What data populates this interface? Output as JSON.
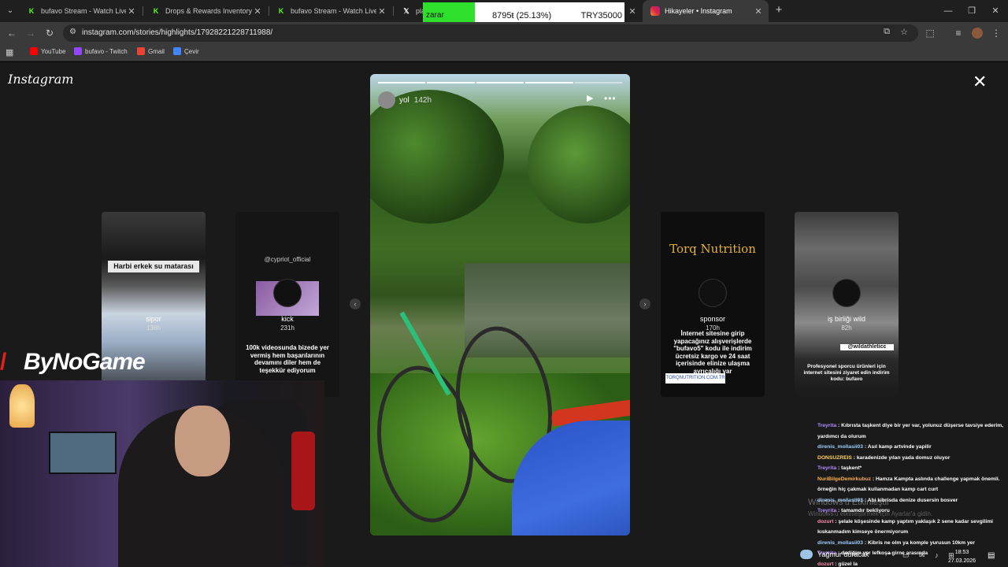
{
  "browser": {
    "tabs": [
      {
        "title": "bufavo Stream - Watch Live on",
        "icon": "kick-icon",
        "active": false
      },
      {
        "title": "Drops & Rewards Inventory - K",
        "icon": "kick-icon",
        "active": false
      },
      {
        "title": "bufavo Stream - Watch Live on",
        "icon": "kick-icon",
        "active": false
      },
      {
        "title": "plat",
        "icon": "x-icon",
        "active": false
      },
      {
        "title": "Hikayeler • Instagram",
        "icon": "instagram-icon",
        "active": true
      }
    ],
    "url": "instagram.com/stories/highlights/17928221228711988/",
    "bookmarks": [
      {
        "label": "YouTube",
        "color": "#ff0000"
      },
      {
        "label": "bufavo - Twitch",
        "color": "#9146ff"
      },
      {
        "label": "Gmail",
        "color": "#ea4335"
      },
      {
        "label": "Çevir",
        "color": "#4285f4"
      }
    ]
  },
  "price_overlay": {
    "status": "zarar",
    "change": "8795ŧ (25.13%)",
    "currency": "TRY35000"
  },
  "instagram": {
    "logo": "Instagram",
    "story": {
      "username": "yol",
      "time": "142h",
      "segments_total": 5,
      "segments_done": 4
    },
    "thumbnails": [
      {
        "name": "sipor",
        "time": "138h",
        "header": "Harbi erkek su matarası",
        "caption": ""
      },
      {
        "name": "kick",
        "time": "231h",
        "header": "",
        "top": "@cypriot_official",
        "caption": "100k videosunda bizede yer vermiş hem başarılarının devamını diler hem de teşekkür ediyorum"
      },
      {
        "name": "sponsor",
        "time": "170h",
        "header": "",
        "top": "Torq Nutrition",
        "caption": "İnternet sitesine girip yapacağınız alışverişlerde \"bufavo5\" kodu ile indirim ücretsiz kargo ve 24 saat içerisinde elinize ulaşma ayrıcalığı var",
        "link": "TORQNUTRITION.COM.TR"
      },
      {
        "name": "iş birliği wild",
        "time": "82h",
        "header": "",
        "top": "@wildathleticc",
        "caption": "Profesyonel sporcu ürünleri için internet sitesini ziyaret edin indirim kodu: bufavo"
      }
    ]
  },
  "stream_overlay": {
    "brand": "ByNoGame"
  },
  "chat": [
    {
      "user": "Treyrita",
      "msg": "Kıbrısta taşkent diye bir yer var, yolunuz düşerse tavsiye ederim, yardımcı da olurum",
      "color": "#b48cff"
    },
    {
      "user": "direnis_mollasii03",
      "msg": "Asıl kamp artvinde yapilir",
      "color": "#9fd0ff"
    },
    {
      "user": "DONSUZREIS",
      "msg": "karadenizde yılan yada domuz oluyor",
      "color": "#ffd25a"
    },
    {
      "user": "Treyrita",
      "msg": "taşkent*",
      "color": "#b48cff"
    },
    {
      "user": "NuriBilgeDemirkubuz",
      "msg": "Hamza Kampta aslında challenge yapmak önemli. örneğin hiç çakmak kullanmadan kamp cart curt",
      "color": "#ffb04a"
    },
    {
      "user": "direnis_mollasii03",
      "msg": "Abi kibrisda denize dusersin bosver",
      "color": "#9fd0ff"
    },
    {
      "user": "Treyrita",
      "msg": "tamamdır bekliyoru",
      "color": "#b48cff"
    },
    {
      "user": "dozurt",
      "msg": "şelale köşesinde kamp yaptım yaklaşık 2 sene kadar sevgilimi kıskanmadım kimseye önermiyorum",
      "color": "#ff8fb0"
    },
    {
      "user": "direnis_mollasii03",
      "msg": "Kibris ne olm ya komple yurusun 10km yer",
      "color": "#9fd0ff"
    },
    {
      "user": "Treyrita",
      "msg": "dediğim yer lefkoşa girne arasında",
      "color": "#b48cff"
    },
    {
      "user": "dozurt",
      "msg": "güzel la",
      "color": "#ff8fb0"
    }
  ],
  "windows": {
    "watermark": "Windows'u Etkinleştir",
    "watermark_sub": "Windows'u etkinleştirmek için Ayarlar'a gidin.",
    "weather": "Yağmur duracak",
    "time": "18:53",
    "date": "27.03.2026"
  }
}
